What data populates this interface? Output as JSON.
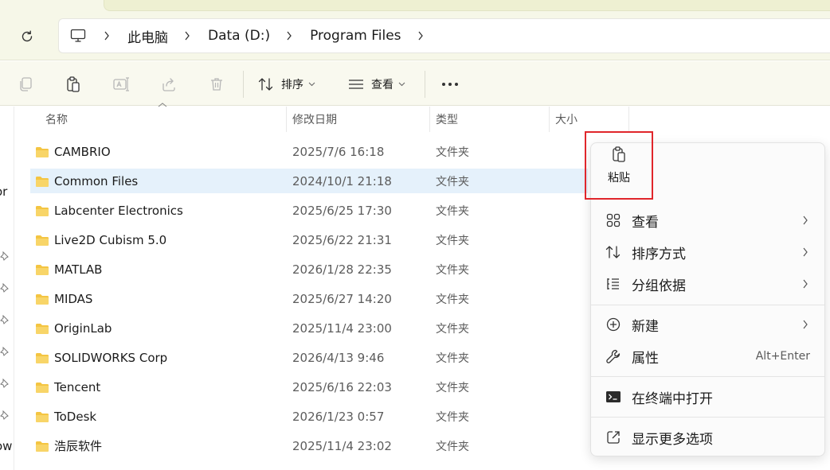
{
  "address": {
    "crumbs": [
      "此电脑",
      "Data (D:)",
      "Program Files"
    ]
  },
  "toolbar": {
    "sort_label": "排序",
    "view_label": "查看"
  },
  "left_nav": {
    "partial_text_1": "or",
    "partial_text_2": "ow"
  },
  "columns": {
    "name": "名称",
    "modified": "修改日期",
    "type": "类型",
    "size": "大小"
  },
  "files": [
    {
      "name": "CAMBRIO",
      "date": "2025/7/6 16:18",
      "type": "文件夹"
    },
    {
      "name": "Common Files",
      "date": "2024/10/1 21:18",
      "type": "文件夹"
    },
    {
      "name": "Labcenter Electronics",
      "date": "2025/6/25 17:30",
      "type": "文件夹"
    },
    {
      "name": "Live2D Cubism 5.0",
      "date": "2025/6/22 21:31",
      "type": "文件夹"
    },
    {
      "name": "MATLAB",
      "date": "2026/1/28 22:35",
      "type": "文件夹"
    },
    {
      "name": "MIDAS",
      "date": "2025/6/27 14:20",
      "type": "文件夹"
    },
    {
      "name": "OriginLab",
      "date": "2025/11/4 23:00",
      "type": "文件夹"
    },
    {
      "name": "SOLIDWORKS Corp",
      "date": "2026/4/13 9:46",
      "type": "文件夹"
    },
    {
      "name": "Tencent",
      "date": "2025/6/16 22:03",
      "type": "文件夹"
    },
    {
      "name": "ToDesk",
      "date": "2026/1/23 0:57",
      "type": "文件夹"
    },
    {
      "name": "浩辰软件",
      "date": "2025/11/4 23:02",
      "type": "文件夹"
    }
  ],
  "context_menu": {
    "paste_label": "粘贴",
    "view": "查看",
    "sort_by": "排序方式",
    "group_by": "分组依据",
    "new": "新建",
    "properties": "属性",
    "properties_shortcut": "Alt+Enter",
    "open_terminal": "在终端中打开",
    "more_options": "显示更多选项"
  },
  "colors": {
    "accent_highlight": "#e0262b",
    "selected_row": "#e5f1fb",
    "folder": "#f4c542"
  }
}
